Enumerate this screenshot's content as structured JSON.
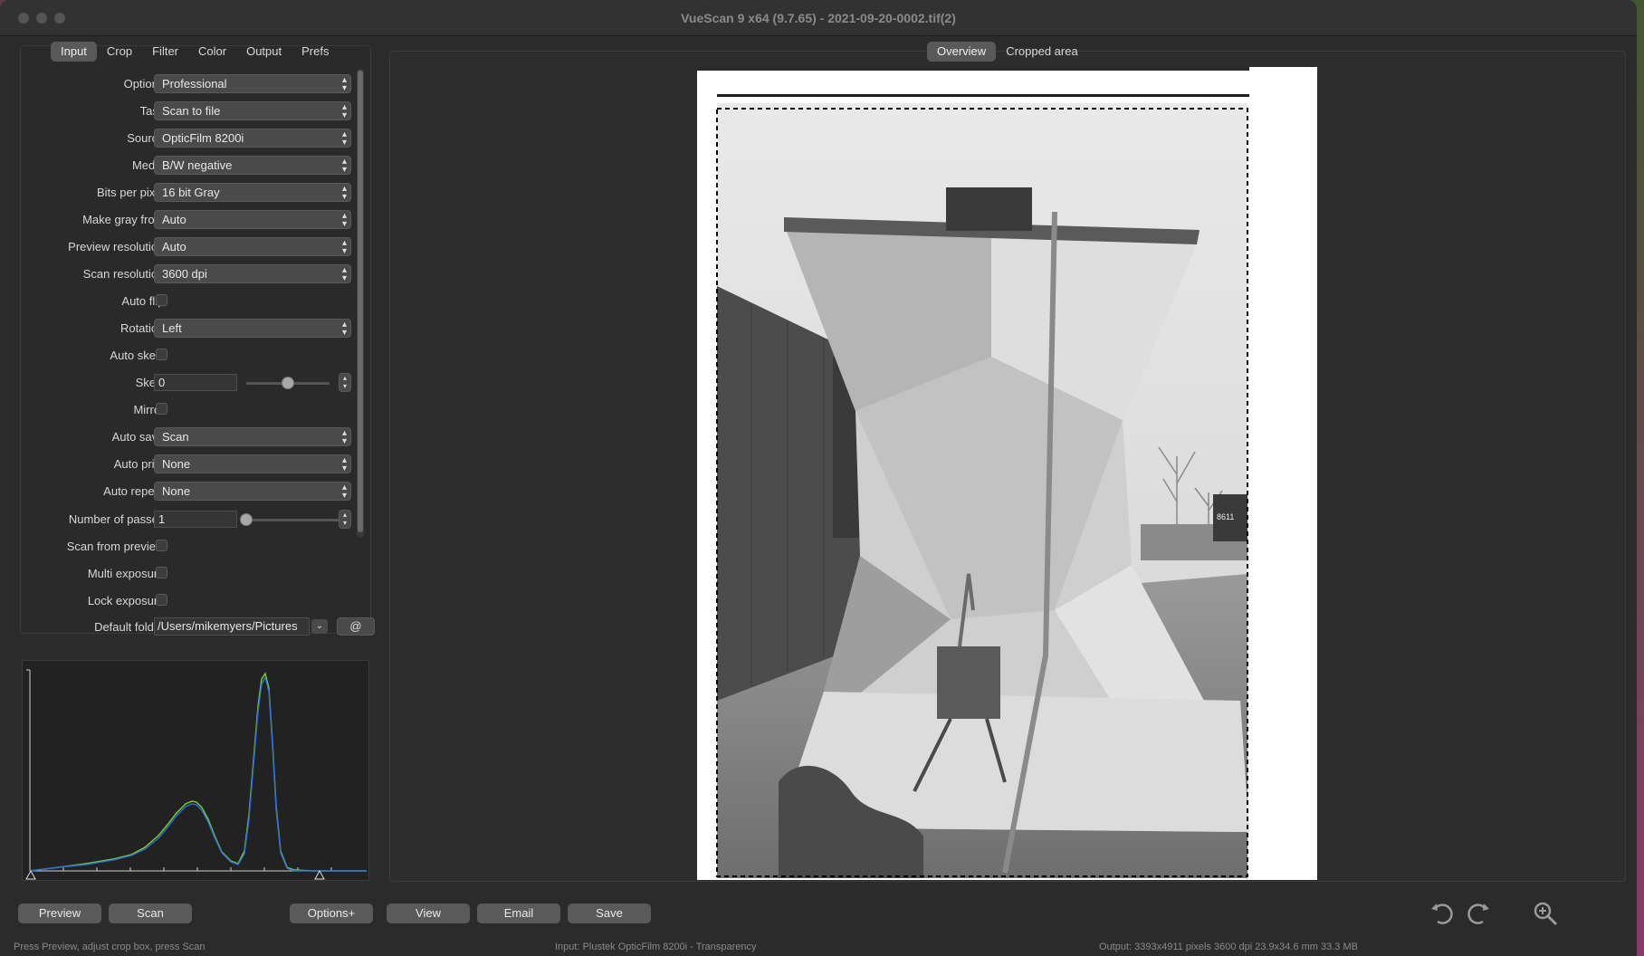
{
  "window": {
    "title": "VueScan 9 x64 (9.7.65) - 2021-09-20-0002.tif(2)"
  },
  "left_tabs": [
    "Input",
    "Crop",
    "Filter",
    "Color",
    "Output",
    "Prefs"
  ],
  "active_left_tab": "Input",
  "view_tabs": [
    "Overview",
    "Cropped area"
  ],
  "active_view_tab": "Overview",
  "input": {
    "options": {
      "label": "Options:",
      "value": "Professional"
    },
    "task": {
      "label": "Task:",
      "value": "Scan to file"
    },
    "source": {
      "label": "Source:",
      "value": "OpticFilm 8200i"
    },
    "media": {
      "label": "Media:",
      "value": "B/W negative"
    },
    "bits_per_pixel": {
      "label": "Bits per pixel:",
      "value": "16 bit Gray"
    },
    "make_gray_from": {
      "label": "Make gray from:",
      "value": "Auto"
    },
    "preview_resolution": {
      "label": "Preview resolution:",
      "value": "Auto"
    },
    "scan_resolution": {
      "label": "Scan resolution:",
      "value": "3600 dpi"
    },
    "auto_flip": {
      "label": "Auto flip:",
      "checked": false
    },
    "rotation": {
      "label": "Rotation:",
      "value": "Left"
    },
    "auto_skew": {
      "label": "Auto skew:",
      "checked": false
    },
    "skew": {
      "label": "Skew:",
      "value": "0",
      "level": 0.5
    },
    "mirror": {
      "label": "Mirror:",
      "checked": false
    },
    "auto_save": {
      "label": "Auto save:",
      "value": "Scan"
    },
    "auto_print": {
      "label": "Auto print:",
      "value": "None"
    },
    "auto_repeat": {
      "label": "Auto repeat:",
      "value": "None"
    },
    "number_of_passes": {
      "label": "Number of passes:",
      "value": "1",
      "level": 0.0
    },
    "scan_from_preview": {
      "label": "Scan from preview:",
      "checked": false
    },
    "multi_exposure": {
      "label": "Multi exposure:",
      "checked": false
    },
    "lock_exposure": {
      "label": "Lock exposure:",
      "checked": false
    },
    "default_folder": {
      "label": "Default folder:",
      "value": "/Users/mikemyers/Pictures",
      "button": "@"
    }
  },
  "bottom_buttons": {
    "preview": "Preview",
    "scan": "Scan",
    "options_plus": "Options+",
    "view": "View",
    "email": "Email",
    "save": "Save"
  },
  "status": {
    "left": "Press Preview, adjust crop box, press Scan",
    "center": "Input: Plustek OpticFilm 8200i - Transparency",
    "right": "Output: 3393x4911 pixels 3600 dpi 23.9x34.6 mm 33.3 MB"
  },
  "preview_image": {
    "locomotive_number": "8611"
  },
  "icons": {
    "undo": "rotate-left-icon",
    "redo": "rotate-right-icon",
    "zoom": "zoom-in-icon"
  },
  "colors": {
    "histogram_green": "#7ed321",
    "histogram_blue": "#2d6cdf"
  }
}
